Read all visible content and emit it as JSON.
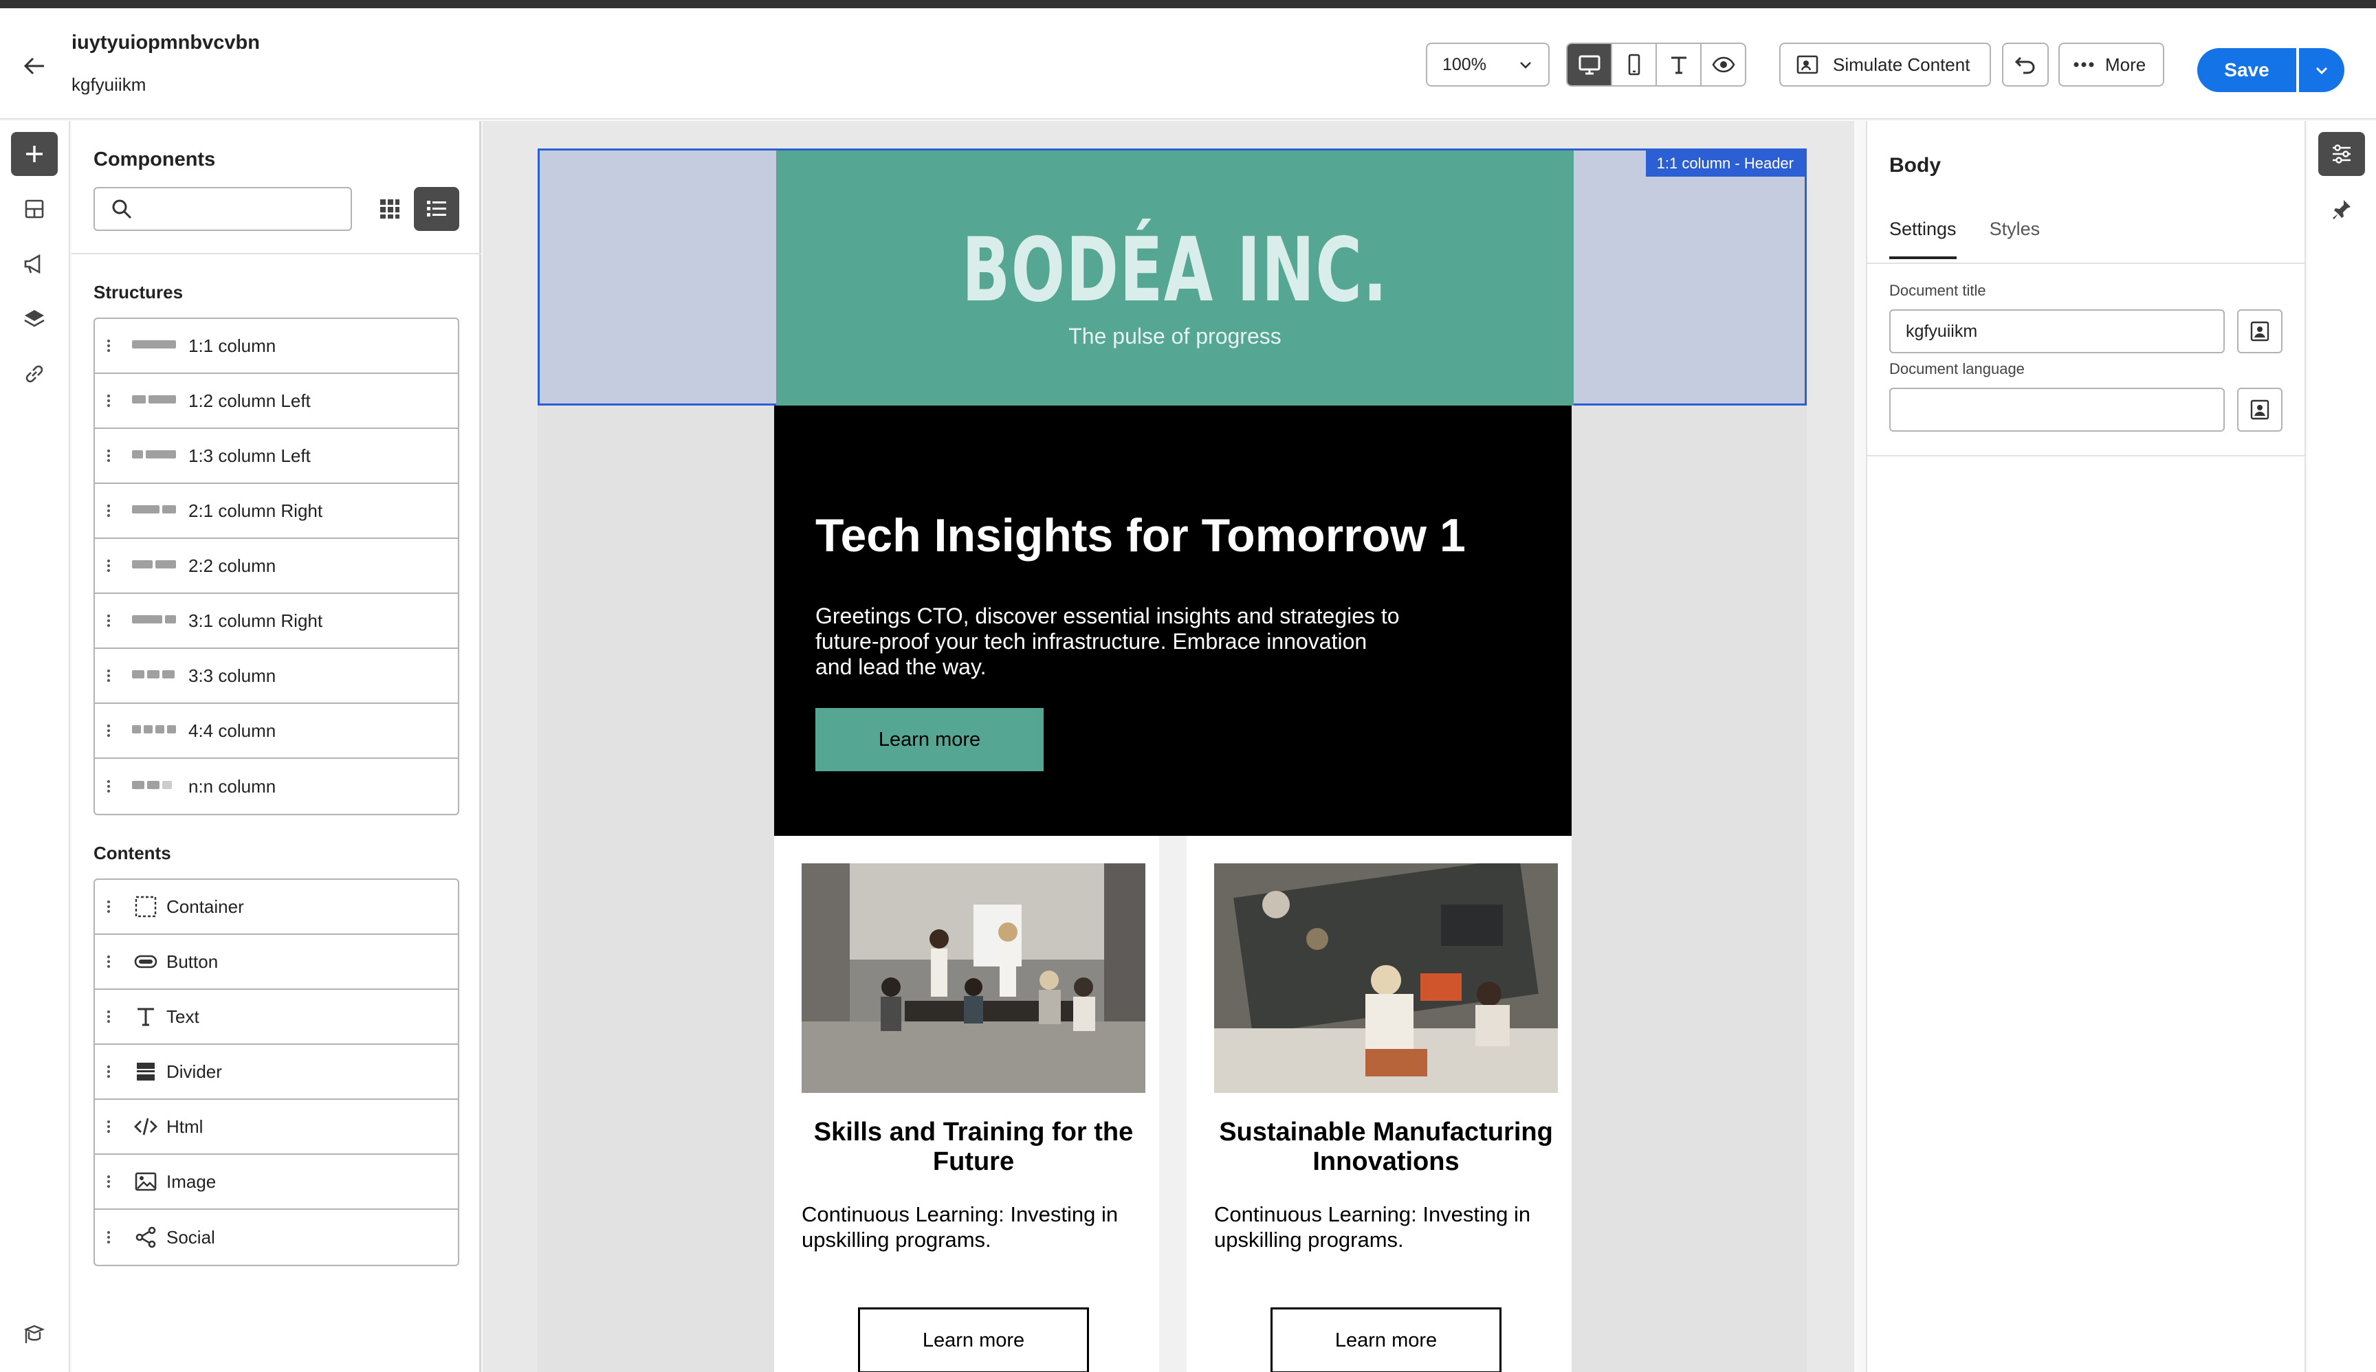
{
  "header": {
    "doc_name": "iuytyuiopmnbvcvbn",
    "doc_subtitle": "kgfyuiikm",
    "zoom": "100%",
    "simulate_label": "Simulate Content",
    "more_label": "More",
    "save_label": "Save"
  },
  "components": {
    "title": "Components",
    "search_placeholder": "",
    "structures_label": "Structures",
    "structures": [
      {
        "label": "1:1 column"
      },
      {
        "label": "1:2 column Left"
      },
      {
        "label": "1:3 column Left"
      },
      {
        "label": "2:1 column Right"
      },
      {
        "label": "2:2 column"
      },
      {
        "label": "3:1 column Right"
      },
      {
        "label": "3:3 column"
      },
      {
        "label": "4:4 column"
      },
      {
        "label": "n:n column"
      }
    ],
    "contents_label": "Contents",
    "contents": [
      {
        "label": "Container",
        "icon": "container-icon"
      },
      {
        "label": "Button",
        "icon": "button-icon"
      },
      {
        "label": "Text",
        "icon": "text-icon"
      },
      {
        "label": "Divider",
        "icon": "divider-icon"
      },
      {
        "label": "Html",
        "icon": "code-icon"
      },
      {
        "label": "Image",
        "icon": "image-icon"
      },
      {
        "label": "Social",
        "icon": "share-icon"
      }
    ]
  },
  "canvas": {
    "selection_tag": "1:1 column - Header",
    "logo": "BODÉA INC.",
    "tagline": "The pulse of progress",
    "hero": {
      "title": "Tech Insights for Tomorrow 1",
      "text": "Greetings CTO, discover essential insights and strategies to future-proof your tech infrastructure. Embrace innovation and lead the way.",
      "button": "Learn more"
    },
    "cards": [
      {
        "title": "Skills and Training for the Future",
        "text": "Continuous Learning: Investing in upskilling programs.",
        "button": "Learn more",
        "image": "meeting-photo"
      },
      {
        "title": "Sustainable Manufacturing Innovations",
        "text": "Continuous Learning: Investing in upskilling programs.",
        "button": "Learn more",
        "image": "desk-team-photo"
      }
    ]
  },
  "properties": {
    "title": "Body",
    "tabs": [
      "Settings",
      "Styles"
    ],
    "active_tab": "Settings",
    "doc_title_label": "Document title",
    "doc_title_value": "kgfyuiikm",
    "doc_lang_label": "Document language",
    "doc_lang_value": ""
  },
  "colors": {
    "accent": "#1473e6",
    "brand_green": "#55a693",
    "selection_blue": "#2d5fd4",
    "hero_bg": "#000000"
  }
}
